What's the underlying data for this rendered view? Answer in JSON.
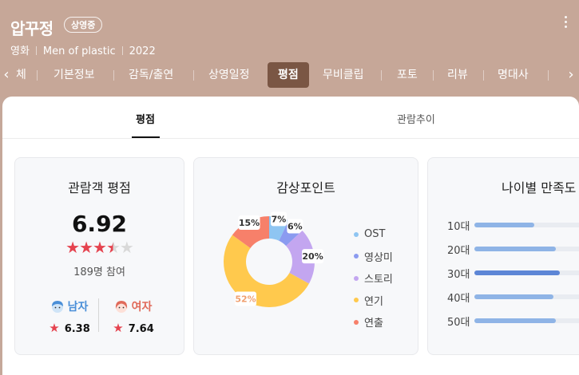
{
  "header": {
    "title": "압꾸정",
    "status_badge": "상영중",
    "meta": [
      "영화",
      "Men of plastic",
      "2022"
    ],
    "tabs": [
      {
        "label": "체",
        "active": false
      },
      {
        "label": "기본정보",
        "active": false
      },
      {
        "label": "감독/출연",
        "active": false
      },
      {
        "label": "상영일정",
        "active": false
      },
      {
        "label": "평점",
        "active": true
      },
      {
        "label": "무비클립",
        "active": false
      },
      {
        "label": "포토",
        "active": false
      },
      {
        "label": "리뷰",
        "active": false
      },
      {
        "label": "명대사",
        "active": false
      }
    ],
    "colors": {
      "header_bg": "#c6a798",
      "active_tab_bg": "#7a5644"
    }
  },
  "subtabs": [
    {
      "label": "평점",
      "active": true
    },
    {
      "label": "관람추이",
      "active": false
    }
  ],
  "audience_rating": {
    "title": "관람객 평점",
    "score": "6.92",
    "stars_filled": 3.5,
    "stars_total": 5,
    "participants": "189명 참여",
    "male": {
      "label": "남자",
      "score": "6.38",
      "color": "#4a8fd8"
    },
    "female": {
      "label": "여자",
      "score": "7.64",
      "color": "#e06a5a"
    },
    "star_color": "#e5434f"
  },
  "viewing_points": {
    "title": "감상포인트",
    "chart_data": {
      "type": "pie",
      "donut": true,
      "categories": [
        "OST",
        "영상미",
        "스토리",
        "연기",
        "연출"
      ],
      "values": [
        7,
        6,
        20,
        52,
        15
      ],
      "value_labels": [
        "7%",
        "6%",
        "20%",
        "52%",
        "15%"
      ],
      "colors": [
        "#8ec5f2",
        "#8b9bf0",
        "#c3a6f0",
        "#ffc94d",
        "#f7806a"
      ],
      "legend_position": "right"
    }
  },
  "age_satisfaction": {
    "title": "나이별 만족도",
    "chart_data": {
      "type": "bar",
      "orientation": "horizontal",
      "categories": [
        "10대",
        "20대",
        "30대",
        "40대",
        "50대"
      ],
      "values": [
        0.5,
        0.68,
        0.71,
        0.66,
        0.68
      ],
      "highlight": "30대",
      "colors": {
        "bar": "#8fb4e6",
        "highlight": "#5d86d6",
        "track": "#e9ecf1"
      }
    }
  }
}
